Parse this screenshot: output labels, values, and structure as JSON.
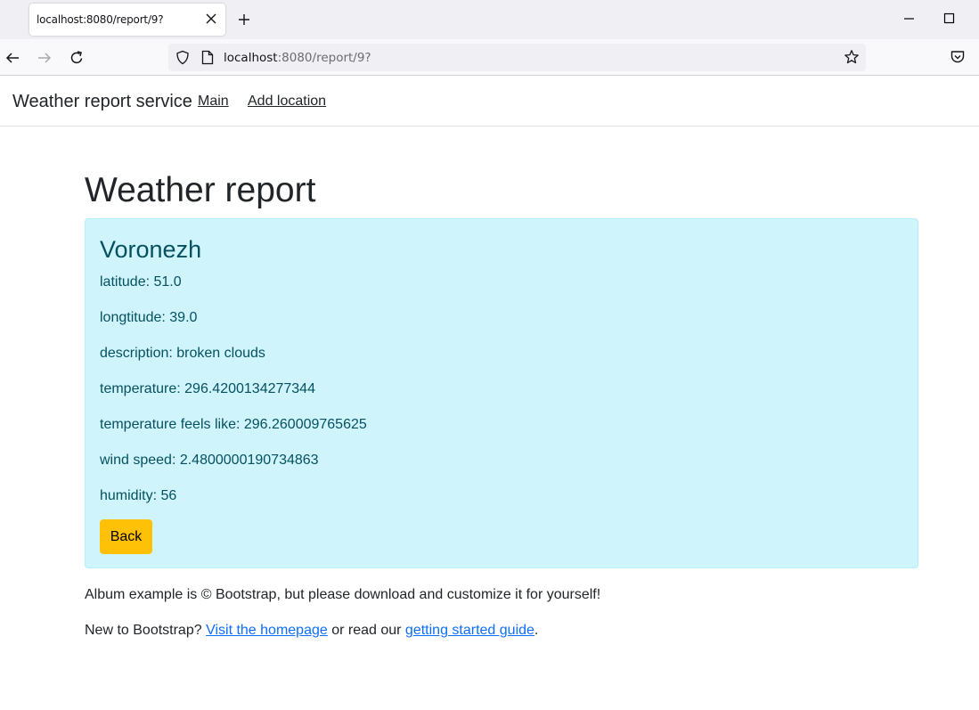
{
  "browser": {
    "tab_title": "localhost:8080/report/9?",
    "url_host": "localhost",
    "url_rest": ":8080/report/9?"
  },
  "header": {
    "brand": "Weather report service",
    "nav": [
      {
        "label": "Main"
      },
      {
        "label": "Add location"
      }
    ]
  },
  "main": {
    "title": "Weather report",
    "city": "Voronezh",
    "fields": [
      "latitude: 51.0",
      "longtitude: 39.0",
      "description: broken clouds",
      "temperature: 296.4200134277344",
      "temperature feels like: 296.260009765625",
      "wind speed: 2.4800000190734863",
      "humidity: 56"
    ],
    "back_label": "Back"
  },
  "footer": {
    "line1": "Album example is © Bootstrap, but please download and customize it for yourself!",
    "line2_prefix": "New to Bootstrap? ",
    "homepage_link": "Visit the homepage",
    "line2_mid": " or read our ",
    "guide_link": "getting started guide",
    "line2_suffix": "."
  },
  "colors": {
    "alert_bg": "#cff4fc",
    "alert_text": "#055160",
    "button_warning": "#ffc107",
    "link": "#0d6efd"
  },
  "icons": [
    "close-icon",
    "plus-icon",
    "minimize-icon",
    "maximize-icon",
    "back-arrow-icon",
    "forward-arrow-icon",
    "reload-icon",
    "shield-icon",
    "page-icon",
    "star-icon",
    "pocket-icon"
  ]
}
